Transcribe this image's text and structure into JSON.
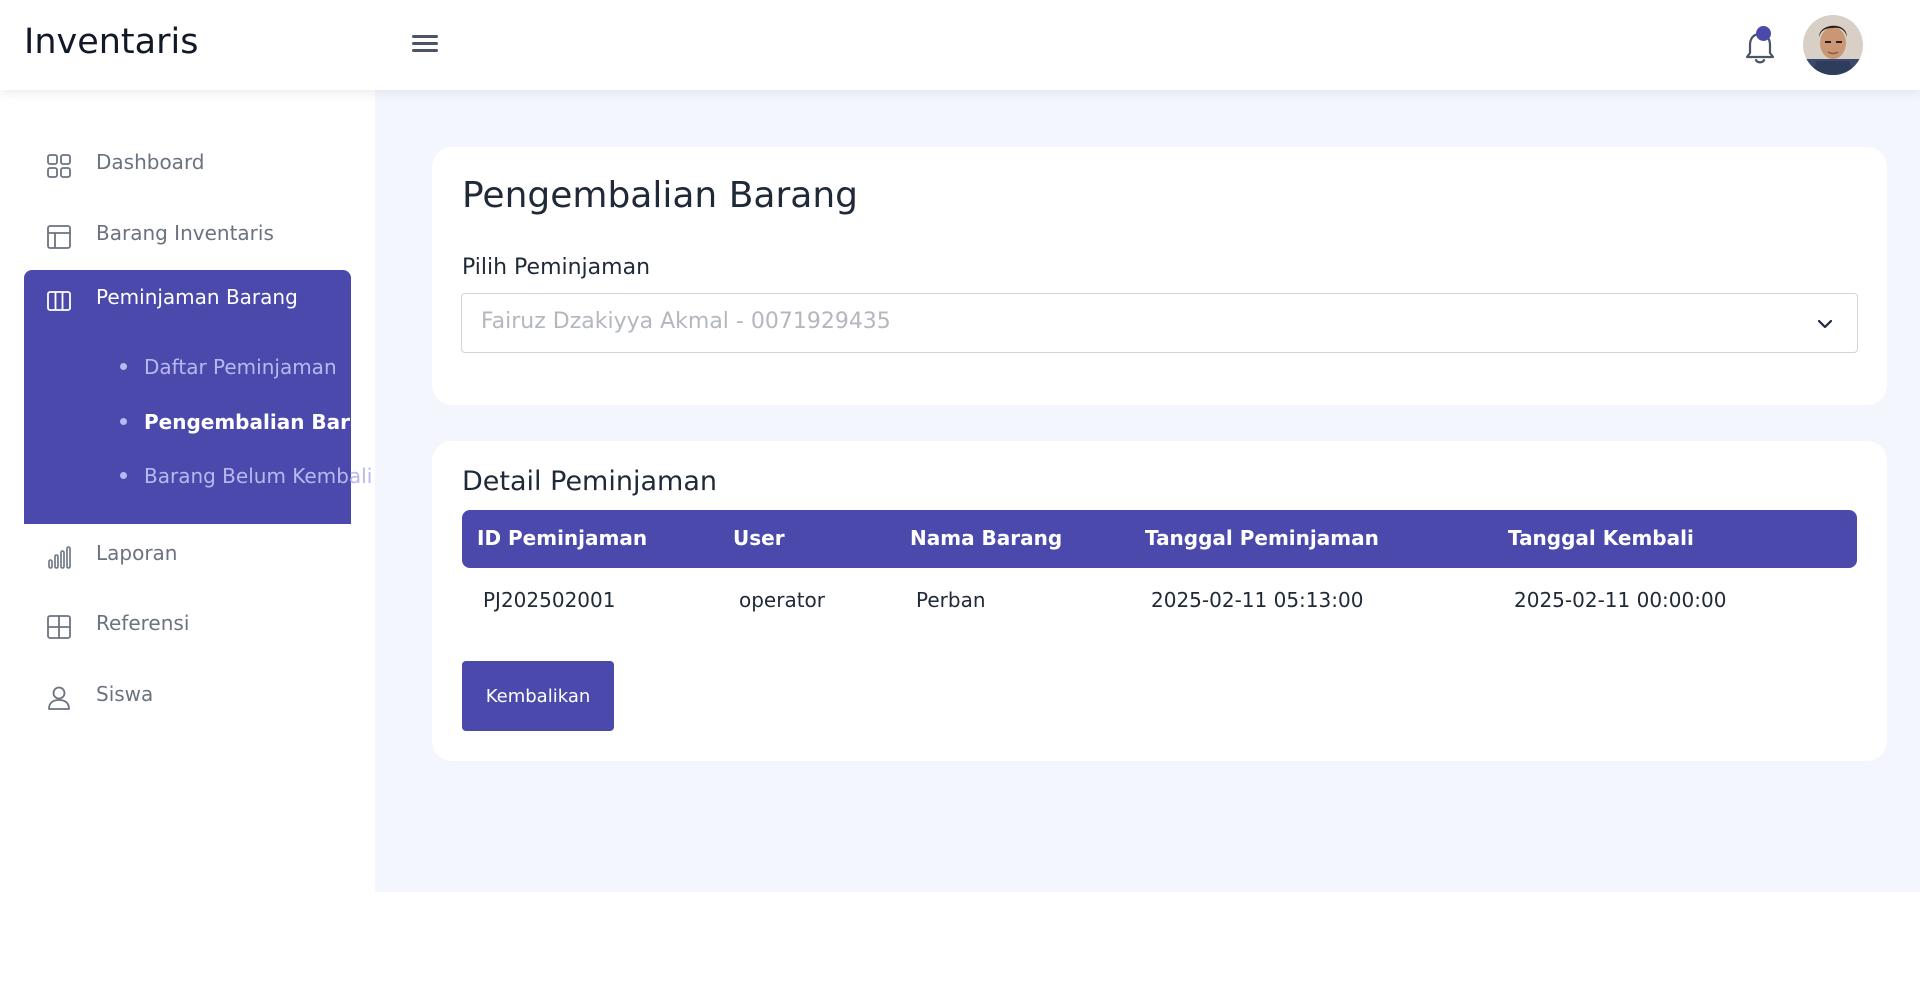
{
  "app": {
    "title": "Inventaris"
  },
  "colors": {
    "primary": "#4b49ac",
    "background": "#f4f6fd"
  },
  "header": {
    "menu_icon": "hamburger-icon",
    "notification_icon": "bell-icon",
    "avatar_icon": "user-avatar"
  },
  "sidebar": {
    "items": [
      {
        "label": "Dashboard",
        "icon": "grid-icon"
      },
      {
        "label": "Barang Inventaris",
        "icon": "layout-icon"
      },
      {
        "label": "Peminjaman Barang",
        "icon": "columns-icon",
        "active": true
      },
      {
        "label": "Laporan",
        "icon": "bar-chart-icon"
      },
      {
        "label": "Referensi",
        "icon": "table-icon"
      },
      {
        "label": "Siswa",
        "icon": "user-icon"
      }
    ],
    "submenu": [
      {
        "label": "Daftar Peminjaman"
      },
      {
        "label": "Pengembalian Barang",
        "active": true
      },
      {
        "label": "Barang Belum Kembali"
      }
    ]
  },
  "form": {
    "title": "Pengembalian Barang",
    "select_label": "Pilih Peminjaman",
    "select_value": "Fairuz Dzakiyya Akmal - 0071929435"
  },
  "detail": {
    "title": "Detail Peminjaman",
    "columns": [
      "ID Peminjaman",
      "User",
      "Nama Barang",
      "Tanggal Peminjaman",
      "Tanggal Kembali"
    ],
    "rows": [
      [
        "PJ202502001",
        "operator",
        "Perban",
        "2025-02-11 05:13:00",
        "2025-02-11 00:00:00"
      ]
    ],
    "button_label": "Kembalikan"
  }
}
